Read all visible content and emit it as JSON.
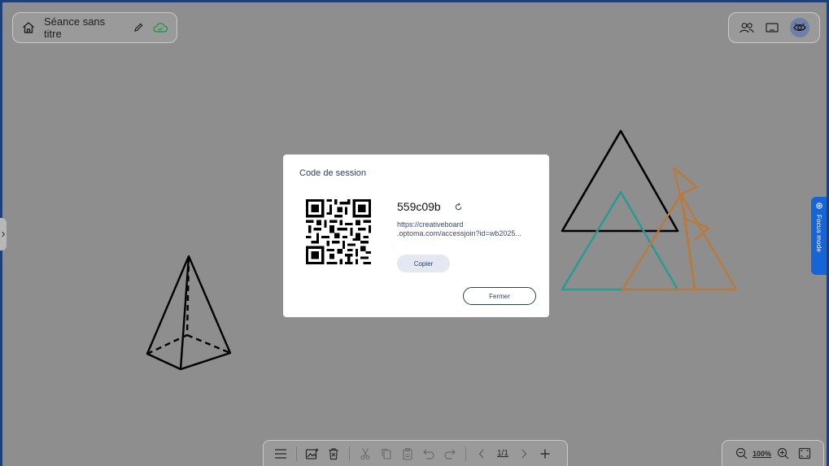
{
  "header": {
    "session_title": "Séance sans titre"
  },
  "dialog": {
    "title": "Code de session",
    "session_code": "559c09b",
    "url_line1": "https://creativeboard",
    "url_line2": ".optoma.com/accessjoin?id=wb2025...",
    "copy_label": "Copier",
    "close_label": "Fermer"
  },
  "focus_tab": {
    "label": "Focus mode"
  },
  "bottom_toolbar": {
    "page_indicator": "1/1"
  },
  "zoom": {
    "value": "100%"
  },
  "colors": {
    "canvas": "#8e8e8e",
    "frame": "#1f3f78",
    "accent_blue": "#1565d8",
    "teal": "#2a9a93",
    "orange": "#b87a3e",
    "dialog_text": "#2c3e66"
  },
  "icons": [
    "home-icon",
    "pencil-icon",
    "cloud-check-icon",
    "participants-icon",
    "screen-icon",
    "view-icon",
    "chevron-right-icon",
    "focus-icon",
    "refresh-icon",
    "menu-icon",
    "image-icon",
    "trash-icon",
    "cut-icon",
    "copy-icon",
    "paste-icon",
    "undo-icon",
    "redo-icon",
    "prev-page-icon",
    "next-page-icon",
    "add-page-icon",
    "zoom-out-icon",
    "zoom-in-icon",
    "fullscreen-icon"
  ]
}
